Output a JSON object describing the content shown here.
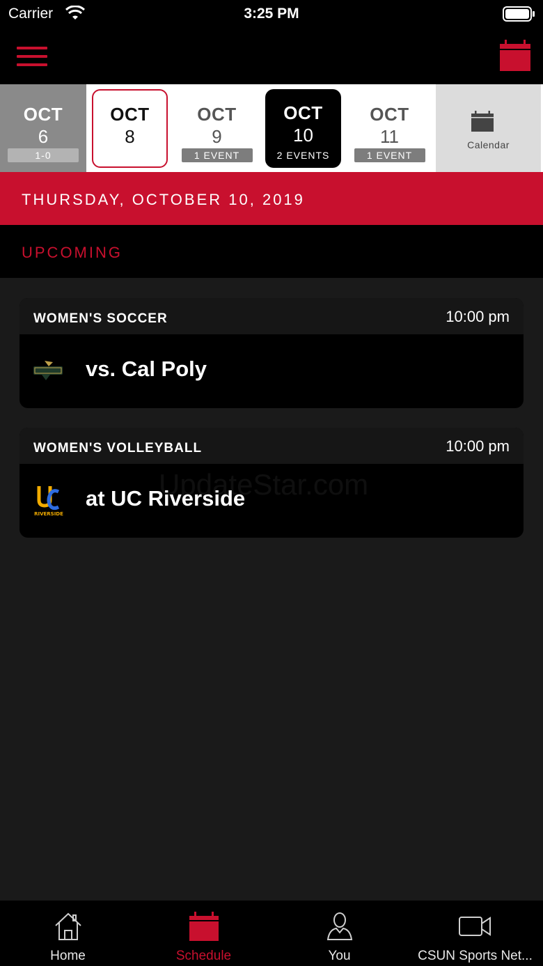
{
  "status_bar": {
    "carrier": "Carrier",
    "time": "3:25 PM"
  },
  "colors": {
    "accent": "#c8102e",
    "background": "#1a1a1a",
    "card": "#000000"
  },
  "date_strip": {
    "days": [
      {
        "month": "OCT",
        "day": "6",
        "badge": "1-0",
        "state": "past"
      },
      {
        "month": "OCT",
        "day": "8",
        "badge": "",
        "state": "today"
      },
      {
        "month": "OCT",
        "day": "9",
        "badge": "1 EVENT",
        "state": "normal"
      },
      {
        "month": "OCT",
        "day": "10",
        "badge": "2 EVENTS",
        "state": "selected"
      },
      {
        "month": "OCT",
        "day": "11",
        "badge": "1 EVENT",
        "state": "normal"
      }
    ],
    "calendar_label": "Calendar"
  },
  "date_header": "THURSDAY, OCTOBER 10, 2019",
  "section_label": "UPCOMING",
  "events": [
    {
      "sport": "WOMEN'S SOCCER",
      "time": "10:00 pm",
      "opponent": "vs. Cal Poly",
      "logo_icon": "cal-poly-logo"
    },
    {
      "sport": "WOMEN'S VOLLEYBALL",
      "time": "10:00 pm",
      "opponent": "at UC Riverside",
      "logo_icon": "uc-riverside-logo",
      "logo_text": "RIVERSIDE"
    }
  ],
  "watermark": "UpdateStar.com",
  "tabs": [
    {
      "label": "Home",
      "icon": "home-icon"
    },
    {
      "label": "Schedule",
      "icon": "calendar-icon",
      "active": true
    },
    {
      "label": "You",
      "icon": "person-icon"
    },
    {
      "label": "CSUN Sports Net...",
      "icon": "video-camera-icon"
    }
  ]
}
